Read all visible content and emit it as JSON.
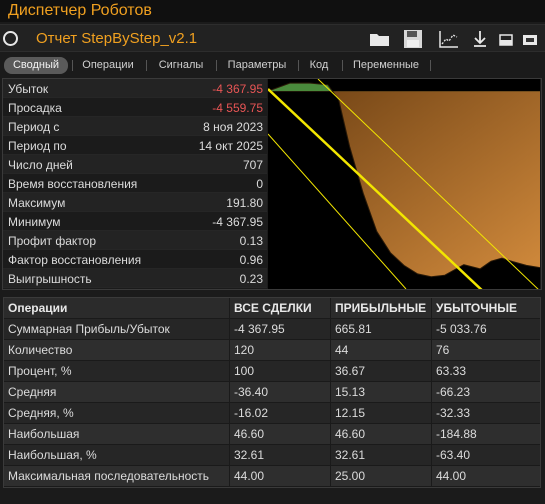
{
  "app": {
    "title": "Диспетчер Роботов"
  },
  "window": {
    "report_title": "Отчет StepByStep_v2.1"
  },
  "header_icons": [
    "folder-icon",
    "save-icon",
    "chart-settings-icon",
    "download-icon",
    "minimize-icon",
    "close-icon"
  ],
  "tabs": [
    {
      "label": "Сводный",
      "active": true
    },
    {
      "label": "Операции",
      "active": false
    },
    {
      "label": "Сигналы",
      "active": false
    },
    {
      "label": "Параметры",
      "active": false
    },
    {
      "label": "Код",
      "active": false
    },
    {
      "label": "Переменные",
      "active": false
    }
  ],
  "stats": [
    {
      "label": "Убыток",
      "value": "-4 367.95",
      "negative": true
    },
    {
      "label": "Просадка",
      "value": "-4 559.75",
      "negative": true
    },
    {
      "label": "Период с",
      "value": "8 ноя 2023",
      "negative": false
    },
    {
      "label": "Период по",
      "value": "14 окт 2025",
      "negative": false
    },
    {
      "label": "Число дней",
      "value": "707",
      "negative": false
    },
    {
      "label": "Время восстановления",
      "value": "0",
      "negative": false
    },
    {
      "label": "Максимум",
      "value": "191.80",
      "negative": false
    },
    {
      "label": "Минимум",
      "value": "-4 367.95",
      "negative": false
    },
    {
      "label": "Профит фактор",
      "value": "0.13",
      "negative": false
    },
    {
      "label": "Фактор восстановления",
      "value": "0.96",
      "negative": false
    },
    {
      "label": "Выигрышность",
      "value": "0.23",
      "negative": false
    }
  ],
  "colors": {
    "accent": "#f0a020",
    "negative": "#e85555",
    "equity_profit": "#4a8a3c",
    "equity_loss": "#b8772c",
    "trend_line": "#f2e600"
  },
  "chart_data": {
    "type": "area",
    "title": "",
    "xlabel": "",
    "ylabel": "",
    "ylim": [
      -4560,
      192
    ],
    "grid": false,
    "x": [
      0,
      0.08,
      0.15,
      0.22,
      0.26,
      0.3,
      0.35,
      0.4,
      0.45,
      0.5,
      0.55,
      0.6,
      0.65,
      0.72,
      0.78,
      0.82,
      0.86,
      0.9,
      0.95,
      1.0
    ],
    "values": [
      0,
      190,
      191.8,
      150,
      -200,
      -1300,
      -2400,
      -3300,
      -3800,
      -4100,
      -4300,
      -4367.95,
      -4330,
      -4080,
      -4180,
      -4000,
      -3930,
      -4010,
      -4100,
      -4150
    ]
  },
  "operations": {
    "headers": [
      "Операции",
      "ВСЕ СДЕЛКИ",
      "ПРИБЫЛЬНЫЕ",
      "УБЫТОЧНЫЕ"
    ],
    "rows": [
      [
        "Суммарная Прибыль/Убыток",
        "-4 367.95",
        "665.81",
        "-5 033.76"
      ],
      [
        "Количество",
        "120",
        "44",
        "76"
      ],
      [
        "Процент, %",
        "100",
        "36.67",
        "63.33"
      ],
      [
        "Средняя",
        "-36.40",
        "15.13",
        "-66.23"
      ],
      [
        "Средняя, %",
        "-16.02",
        "12.15",
        "-32.33"
      ],
      [
        "Наибольшая",
        "46.60",
        "46.60",
        "-184.88"
      ],
      [
        "Наибольшая, %",
        "32.61",
        "32.61",
        "-63.40"
      ],
      [
        "Максимальная последовательность",
        "44.00",
        "25.00",
        "44.00"
      ]
    ]
  }
}
